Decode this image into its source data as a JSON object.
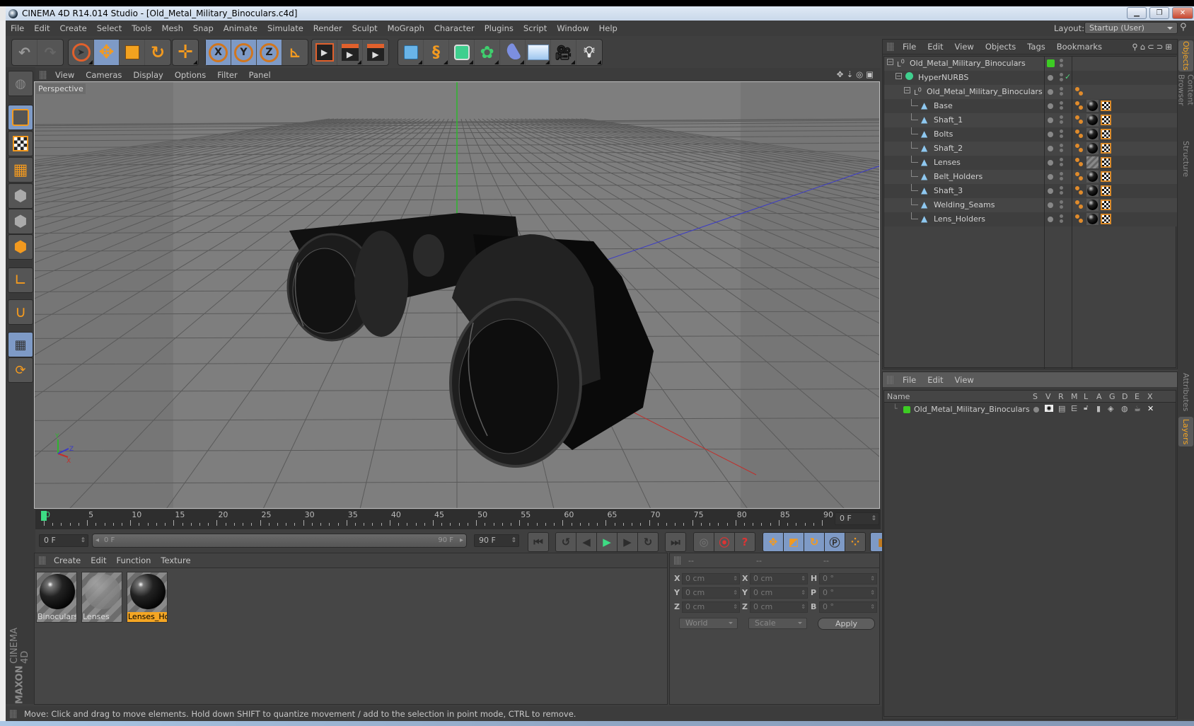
{
  "window": {
    "title": "CINEMA 4D R14.014 Studio - [Old_Metal_Military_Binoculars.c4d]",
    "minimize_icon": "minimize-icon",
    "restore_icon": "restore-icon",
    "close_icon": "close-icon"
  },
  "menubar": {
    "items": [
      "File",
      "Edit",
      "Create",
      "Select",
      "Tools",
      "Mesh",
      "Snap",
      "Animate",
      "Simulate",
      "Render",
      "Sculpt",
      "MoGraph",
      "Character",
      "Plugins",
      "Script",
      "Window",
      "Help"
    ],
    "layout_label": "Layout:",
    "layout_value": "Startup (User)"
  },
  "toolbar": {
    "groups": [
      [
        "undo",
        "redo"
      ],
      [
        "live-selection",
        "move",
        "scale",
        "rotate"
      ],
      [
        "recent-tool"
      ],
      [
        "x-axis-lock",
        "y-axis-lock",
        "z-axis-lock",
        "coordinate-system"
      ],
      [
        "render-view",
        "render-picture-viewer",
        "edit-render-settings"
      ],
      [
        "cube",
        "spline-pen",
        "hypernurbs",
        "array",
        "bend-deformer",
        "floor",
        "camera",
        "light"
      ]
    ]
  },
  "left_toolbar": [
    "make-editable",
    "model-mode",
    "texture-mode",
    "workplane-mode",
    "points-mode",
    "edges-mode",
    "polygons-mode",
    "enable-axis",
    "snapping",
    "locked-workplane",
    "planar-workplane"
  ],
  "viewport": {
    "menu": [
      "View",
      "Cameras",
      "Display",
      "Options",
      "Filter",
      "Panel"
    ],
    "label": "Perspective",
    "axis_labels": {
      "x": "X",
      "y": "Y",
      "z": "Z"
    },
    "nav_icons": [
      "move-view-icon",
      "zoom-view-icon",
      "rotate-view-icon",
      "toggle-panel-icon"
    ],
    "colors": {
      "y_axis": "#2fb52f",
      "x_axis": "#c0302c",
      "z_axis": "#3a3ac8",
      "background": "#7e7e7e"
    }
  },
  "timeline": {
    "ticks": [
      "0",
      "5",
      "10",
      "15",
      "20",
      "25",
      "30",
      "35",
      "40",
      "45",
      "50",
      "55",
      "60",
      "65",
      "70",
      "75",
      "80",
      "85",
      "90"
    ],
    "current_frame": "0 F",
    "start_field": "0 F",
    "range_start": "0 F",
    "range_end": "90 F",
    "end_field": "90 F",
    "playhead_color": "#3ddc84"
  },
  "playback": {
    "buttons": [
      "go-to-start",
      "go-to-previous-key",
      "go-to-previous-frame",
      "play-forwards",
      "go-to-next-frame",
      "go-to-next-key",
      "go-to-end",
      "record-active-objects",
      "autokeying",
      "keyframe-selection",
      "position-key",
      "scale-key",
      "rotation-key",
      "parameter-key",
      "point-level-animation",
      "scheme-settings"
    ]
  },
  "materials": {
    "menu": [
      "Create",
      "Edit",
      "Function",
      "Texture"
    ],
    "items": [
      {
        "name": "Binoculars_",
        "selected": false
      },
      {
        "name": "Lenses",
        "selected": false
      },
      {
        "name": "Lenses_Hol",
        "selected": true
      }
    ]
  },
  "coordinates": {
    "headers": [
      "--",
      "--",
      "--"
    ],
    "rows": [
      {
        "l1": "X",
        "v1": "0 cm",
        "l2": "X",
        "v2": "0 cm",
        "l3": "H",
        "v3": "0 °"
      },
      {
        "l1": "Y",
        "v1": "0 cm",
        "l2": "Y",
        "v2": "0 cm",
        "l3": "P",
        "v3": "0 °"
      },
      {
        "l1": "Z",
        "v1": "0 cm",
        "l2": "Z",
        "v2": "0 cm",
        "l3": "B",
        "v3": "0 °"
      }
    ],
    "mode_select": "World",
    "type_select": "Scale",
    "apply_label": "Apply"
  },
  "status": {
    "text": "Move: Click and drag to move elements. Hold down SHIFT to quantize movement / add to the selection in point mode, CTRL to remove."
  },
  "objects_panel": {
    "menu": [
      "File",
      "Edit",
      "View",
      "Objects",
      "Tags",
      "Bookmarks"
    ],
    "tree": [
      {
        "name": "Old_Metal_Military_Binoculars",
        "type": "null",
        "level": 0,
        "layer_color": "#3dcc24",
        "tags": []
      },
      {
        "name": "HyperNURBS",
        "type": "hypernurbs",
        "level": 1,
        "enabled_check": "✓",
        "tags": []
      },
      {
        "name": "Old_Metal_Military_Binoculars",
        "type": "null",
        "level": 2,
        "tags": [
          "phong"
        ]
      },
      {
        "name": "Base",
        "type": "polygon",
        "level": 3,
        "tags": [
          "phong",
          "material",
          "uvw"
        ]
      },
      {
        "name": "Shaft_1",
        "type": "polygon",
        "level": 3,
        "tags": [
          "phong",
          "material",
          "uvw"
        ]
      },
      {
        "name": "Bolts",
        "type": "polygon",
        "level": 3,
        "tags": [
          "phong",
          "material",
          "uvw"
        ]
      },
      {
        "name": "Shaft_2",
        "type": "polygon",
        "level": 3,
        "tags": [
          "phong",
          "material",
          "uvw"
        ]
      },
      {
        "name": "Lenses",
        "type": "polygon",
        "level": 3,
        "tags": [
          "phong",
          "material-lenses",
          "uvw"
        ]
      },
      {
        "name": "Belt_Holders",
        "type": "polygon",
        "level": 3,
        "tags": [
          "phong",
          "material",
          "uvw"
        ]
      },
      {
        "name": "Shaft_3",
        "type": "polygon",
        "level": 3,
        "tags": [
          "phong",
          "material",
          "uvw"
        ]
      },
      {
        "name": "Welding_Seams",
        "type": "polygon",
        "level": 3,
        "tags": [
          "phong",
          "material",
          "uvw"
        ]
      },
      {
        "name": "Lens_Holders",
        "type": "polygon",
        "level": 3,
        "tags": [
          "phong",
          "material",
          "uvw"
        ]
      }
    ]
  },
  "layers_panel": {
    "menu": [
      "File",
      "Edit",
      "View"
    ],
    "columns": [
      "Name",
      "S",
      "V",
      "R",
      "M",
      "L",
      "A",
      "G",
      "D",
      "E",
      "X"
    ],
    "rows": [
      {
        "name": "Old_Metal_Military_Binoculars",
        "color": "#3dcc24"
      }
    ]
  },
  "right_tabs": {
    "top": [
      "Objects",
      "Content Browser",
      "Structure"
    ],
    "bottom": [
      "Attributes",
      "Layers"
    ]
  },
  "brand": {
    "maxon": "MAXON",
    "product": "CINEMA 4D"
  }
}
